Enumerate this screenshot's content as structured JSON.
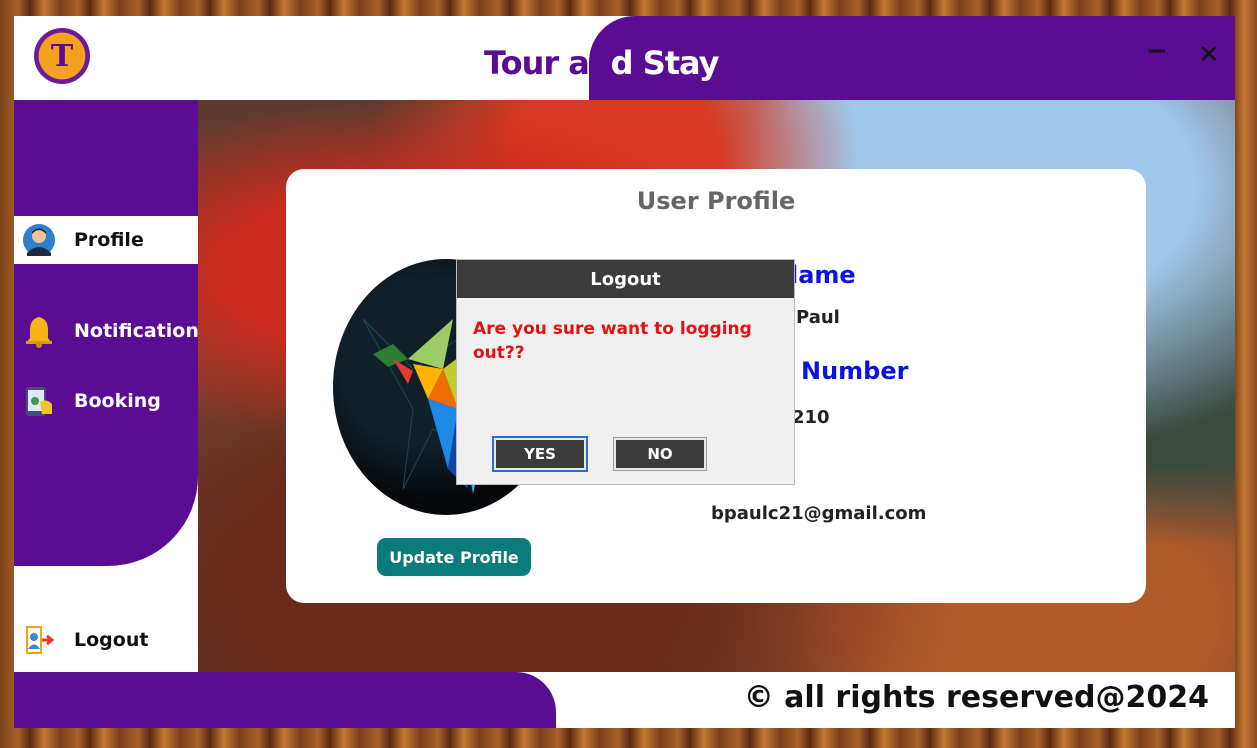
{
  "app": {
    "title_part1": "Tour an",
    "title_part2": "d Stay",
    "logo_letter": "T",
    "minimize_symbol": "−",
    "close_symbol": "✕"
  },
  "sidebar": {
    "items": [
      {
        "label": "Profile",
        "icon": "user-avatar-icon",
        "active": true
      },
      {
        "label": "Notification",
        "icon": "bell-icon",
        "active": false
      },
      {
        "label": "Booking",
        "icon": "booking-icon",
        "active": false
      }
    ],
    "logout_label": "Logout"
  },
  "profile": {
    "title": "User Profile",
    "name_label": "lame",
    "name_value": "Paul",
    "phone_label": "Number",
    "phone_value": "210",
    "email_value": "bpaulc21@gmail.com",
    "update_button": "Update Profile"
  },
  "dialog": {
    "title": "Logout",
    "message": "Are you sure want to logging out??",
    "yes_label": "YES",
    "no_label": "NO"
  },
  "footer": {
    "text": "© all rights reserved@2024"
  },
  "colors": {
    "brand_purple": "#5a0c92",
    "accent_teal": "#0c7b7b",
    "label_blue": "#0a12e6",
    "alert_red": "#e21212"
  }
}
